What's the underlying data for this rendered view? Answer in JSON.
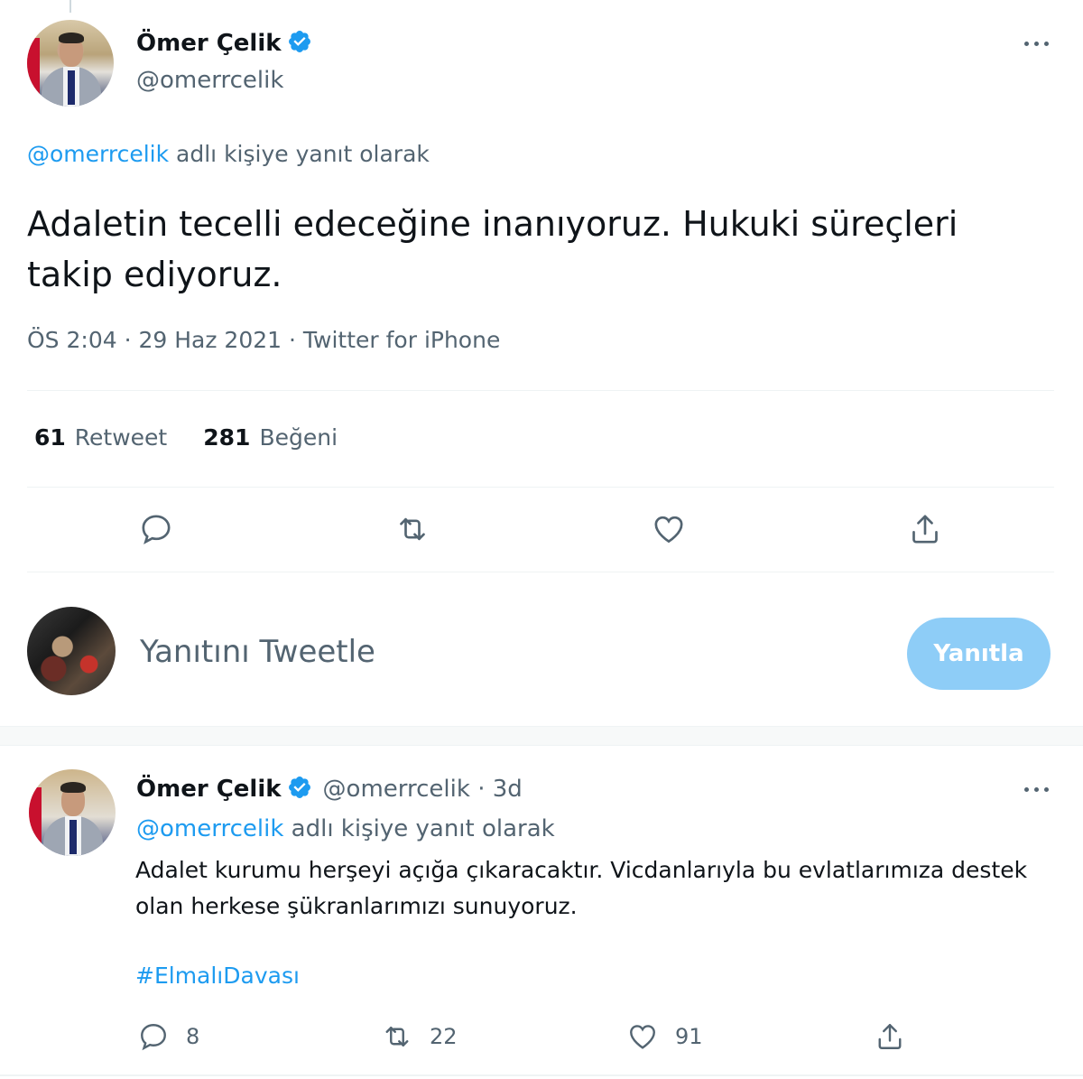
{
  "main_tweet": {
    "author_name": "Ömer Çelik",
    "author_handle": "@omerrcelik",
    "reply_context_handle": "@omerrcelik",
    "reply_context_text": "adlı kişiye yanıt olarak",
    "text": "Adaletin tecelli edeceğine inanıyoruz. Hukuki süreçleri takip ediyoruz.",
    "time": "ÖS 2:04 · 29 Haz 2021 · Twitter for iPhone",
    "retweet_count": "61",
    "retweet_label": "Retweet",
    "like_count": "281",
    "like_label": "Beğeni"
  },
  "compose": {
    "placeholder": "Yanıtını Tweetle",
    "button_label": "Yanıtla"
  },
  "reply_tweet": {
    "author_name": "Ömer Çelik",
    "author_handle": "@omerrcelik · 3d",
    "reply_context_handle": "@omerrcelik",
    "reply_context_text": "adlı kişiye yanıt olarak",
    "text": "Adalet kurumu herşeyi açığa çıkaracaktır. Vicdanlarıyla bu evlatlarımıza destek olan herkese şükranlarımızı sunuyoruz.",
    "hashtag": "#ElmalıDavası",
    "reply_count": "8",
    "retweet_count": "22",
    "like_count": "91"
  },
  "icons": {
    "verified": "verified-badge-icon",
    "reply": "reply-icon",
    "retweet": "retweet-icon",
    "like": "heart-icon",
    "share": "share-icon",
    "more": "more-icon"
  },
  "colors": {
    "accent": "#1d9bf0",
    "muted_text": "#536471",
    "reply_button_disabled": "#8ecdf7"
  }
}
